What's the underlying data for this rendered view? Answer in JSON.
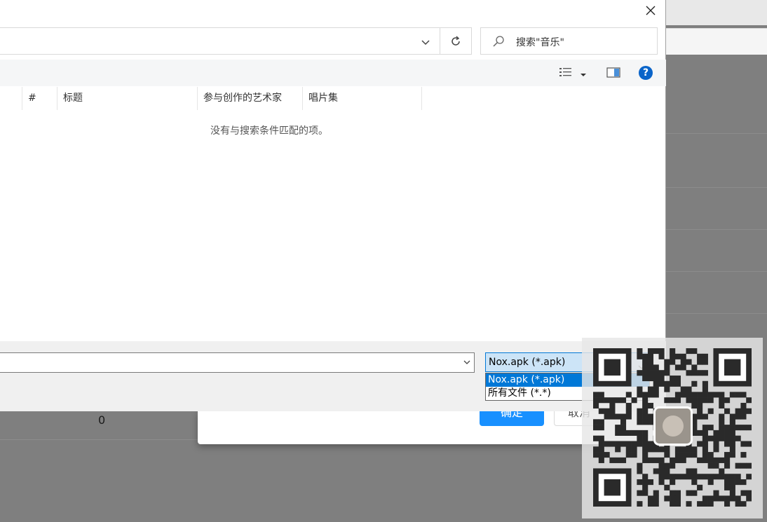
{
  "dialog": {
    "search_placeholder": "搜索\"音乐\"",
    "columns": [
      "#",
      "标题",
      "参与创作的艺术家",
      "唱片集"
    ],
    "empty_message": "没有与搜索条件匹配的项。",
    "filename_value": "",
    "filetype": {
      "selected": "Nox.apk (*.apk)",
      "options": [
        "Nox.apk (*.apk)",
        "所有文件 (*.*)"
      ]
    }
  },
  "background": {
    "cell_value": "0",
    "ok_label": "确定",
    "cancel_label": "取消"
  },
  "colors": {
    "accent": "#0078d7",
    "primary_button": "#1890ff",
    "help_icon": "#0a64c9"
  }
}
